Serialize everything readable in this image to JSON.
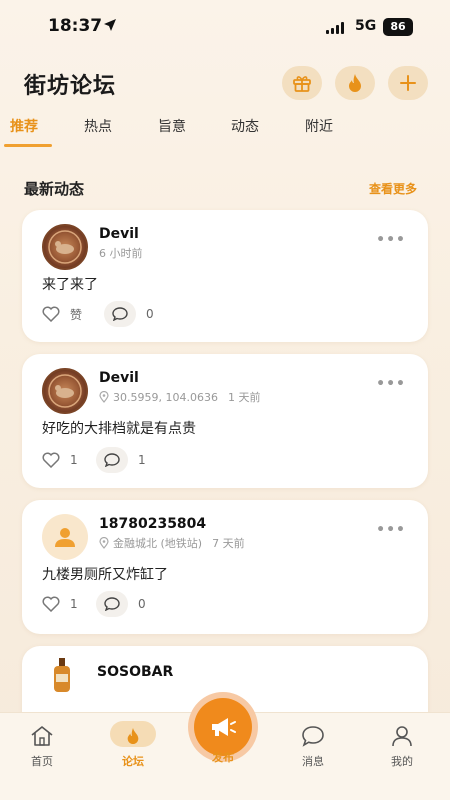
{
  "status_bar": {
    "time": "18:37",
    "network": "5G",
    "battery": "86"
  },
  "header": {
    "title": "街坊论坛"
  },
  "tabs": [
    {
      "label": "推荐",
      "active": true
    },
    {
      "label": "热点"
    },
    {
      "label": "旨意"
    },
    {
      "label": "动态"
    },
    {
      "label": "附近"
    }
  ],
  "section": {
    "title": "最新动态",
    "see_more": "查看更多"
  },
  "posts": [
    {
      "username": "Devil",
      "location": "",
      "time": "6 小时前",
      "content": "来了来了",
      "like_label": "赞",
      "comments": "0",
      "avatar": "coin"
    },
    {
      "username": "Devil",
      "location": "30.5959, 104.0636",
      "time": "1 天前",
      "content": "好吃的大排档就是有点贵",
      "likes": "1",
      "comments": "1",
      "avatar": "coin"
    },
    {
      "username": "18780235804",
      "location": "金融城北 (地铁站)",
      "time": "7 天前",
      "content": "九楼男厕所又炸缸了",
      "likes": "1",
      "comments": "0",
      "avatar": "default"
    },
    {
      "username": "SOSOBAR",
      "avatar": "bottle"
    }
  ],
  "bottom_nav": [
    {
      "label": "首页",
      "icon": "home-icon"
    },
    {
      "label": "论坛",
      "icon": "flame-icon",
      "active": true
    },
    {
      "label": "发布",
      "icon": "megaphone-icon"
    },
    {
      "label": "消息",
      "icon": "chat-icon"
    },
    {
      "label": "我的",
      "icon": "user-icon"
    }
  ],
  "colors": {
    "accent": "#e8921a",
    "background": "#fbf3e9",
    "card": "#ffffff"
  }
}
